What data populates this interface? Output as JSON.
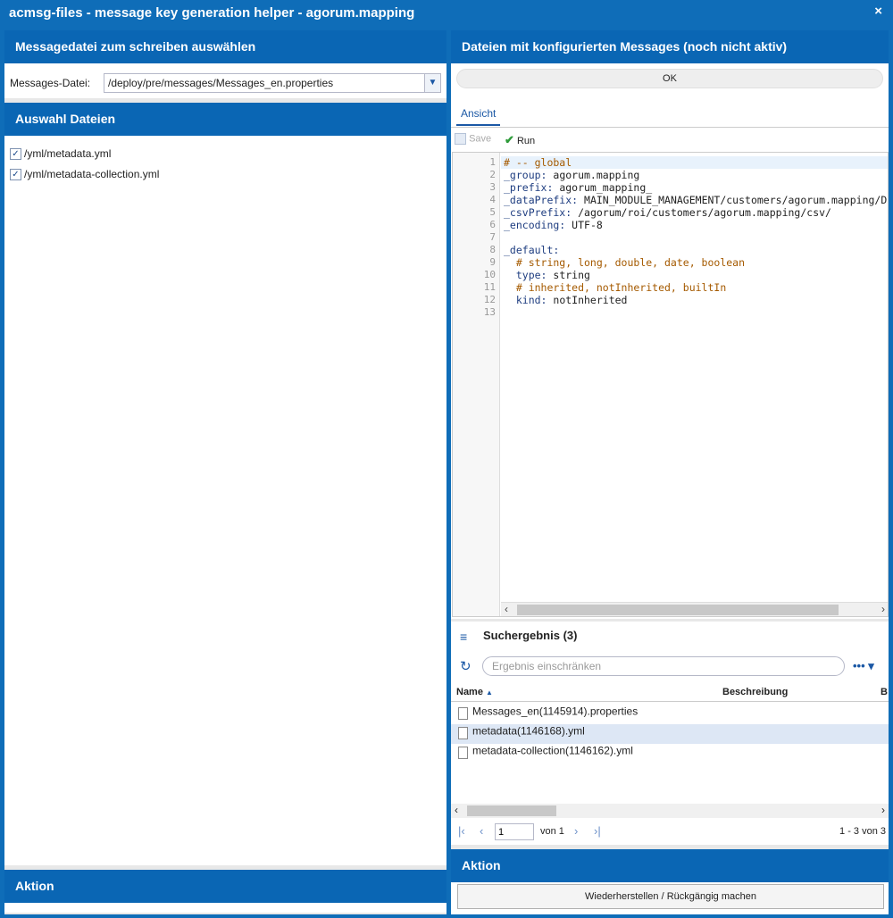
{
  "window": {
    "title": "acmsg-files - message key generation helper - agorum.mapping",
    "close_icon": "×"
  },
  "left": {
    "panel1": {
      "title": "Messagedatei zum schreiben auswählen",
      "field_label": "Messages-Datei:",
      "field_value": "/deploy/pre/messages/Messages_en.properties"
    },
    "panel2": {
      "title": "Auswahl Dateien",
      "files": [
        "/yml/metadata.yml",
        "/yml/metadata-collection.yml"
      ]
    },
    "panel3": {
      "title": "Aktion"
    }
  },
  "right": {
    "panel1": {
      "title": "Dateien mit konfigurierten Messages (noch nicht aktiv)",
      "ok_label": "OK",
      "tab_label": "Ansicht",
      "save_label": "Save",
      "run_label": "Run",
      "code_lines": [
        "# -- global",
        "_group: agorum.mapping",
        "_prefix: agorum_mapping_",
        "_dataPrefix: MAIN_MODULE_MANAGEMENT/customers/agorum.mapping/D",
        "_csvPrefix: /agorum/roi/customers/agorum.mapping/csv/",
        "_encoding: UTF-8",
        "",
        "_default:",
        "  # string, long, double, date, boolean",
        "  type: string",
        "  # inherited, notInherited, builtIn",
        "  kind: notInherited",
        ""
      ]
    },
    "panel2": {
      "title": "Suchergebnis (3)",
      "search_placeholder": "Ergebnis einschränken",
      "columns": {
        "name": "Name",
        "description": "Beschreibung",
        "extra": "B"
      },
      "rows": [
        "Messages_en(1145914).properties",
        "metadata(1146168).yml",
        "metadata-collection(1146162).yml"
      ],
      "page_value": "1",
      "page_of": "von 1",
      "range": "1 - 3 von 3"
    },
    "panel3": {
      "title": "Aktion",
      "button_label": "Wiederherstellen / Rückgängig machen"
    }
  },
  "colors": {
    "header": "#0a66b4",
    "link": "#1b58a5"
  }
}
